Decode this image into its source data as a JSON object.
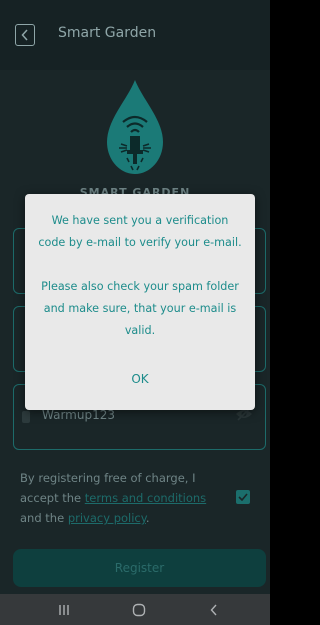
{
  "header": {
    "title": "Smart Garden"
  },
  "brand": {
    "text": "SMART GARDEN"
  },
  "form": {
    "password_value": "Warmup123",
    "consent_text_1": "By registering free of charge, I accept the ",
    "terms_link": "terms and conditions",
    "consent_text_2": " and the ",
    "privacy_link": "privacy policy",
    "consent_text_3": ".",
    "consent_checked": true,
    "register_label": "Register"
  },
  "dialog": {
    "message": "We have sent you a verification code by e-mail to verify your e-mail.\n\nPlease also check your spam folder and make sure, that your e-mail is valid.",
    "ok_label": "OK"
  },
  "colors": {
    "accent": "#1d8c8b",
    "background": "#1a2628",
    "dialog_bg": "#e9e9e9"
  }
}
